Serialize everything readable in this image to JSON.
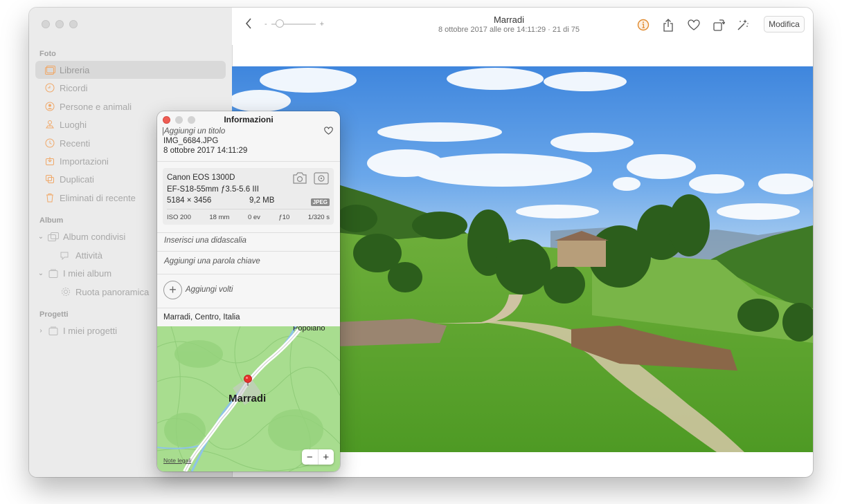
{
  "sidebar": {
    "section_foto": "Foto",
    "items": [
      {
        "label": "Libreria",
        "icon": "library-icon"
      },
      {
        "label": "Ricordi",
        "icon": "memories-icon"
      },
      {
        "label": "Persone e animali",
        "icon": "people-icon"
      },
      {
        "label": "Luoghi",
        "icon": "places-icon"
      },
      {
        "label": "Recenti",
        "icon": "recents-icon"
      },
      {
        "label": "Importazioni",
        "icon": "imports-icon"
      },
      {
        "label": "Duplicati",
        "icon": "duplicates-icon"
      },
      {
        "label": "Eliminati di recente",
        "icon": "trash-icon"
      }
    ],
    "section_album": "Album",
    "album_items": [
      {
        "label": "Album condivisi",
        "icon": "shared-album-icon"
      },
      {
        "label": "Attività",
        "icon": "activity-icon"
      },
      {
        "label": "I miei album",
        "icon": "folder-icon"
      },
      {
        "label": "Ruota panoramica",
        "icon": "gear-icon"
      }
    ],
    "section_progetti": "Progetti",
    "project_items": [
      {
        "label": "I miei progetti",
        "icon": "folder-icon"
      }
    ]
  },
  "toolbar": {
    "title": "Marradi",
    "subtitle": "8 ottobre 2017 alle ore 14:11:29  ·  21 di 75",
    "zoom_minus": "-",
    "zoom_plus": "+",
    "edit_label": "Modifica"
  },
  "info_panel": {
    "title": "Informazioni",
    "title_placeholder": "Aggiungi un titolo",
    "filename": "IMG_6684.JPG",
    "date": "8 ottobre 2017   14:11:29",
    "camera": "Canon EOS 1300D",
    "lens": "EF-S18-55mm ƒ3.5-5.6 III",
    "dimensions": "5184 × 3456",
    "filesize": "9,2 MB",
    "format_badge": "JPEG",
    "iso": "ISO 200",
    "focal": "18 mm",
    "ev": "0 ev",
    "aperture": "ƒ10",
    "shutter": "1/320 s",
    "caption_placeholder": "Inserisci una didascalia",
    "keyword_placeholder": "Aggiungi una parola chiave",
    "add_faces": "Aggiungi volti",
    "location": "Marradi, Centro, Italia",
    "map_city": "Marradi",
    "map_town": "Popolano",
    "legal": "Note legali",
    "zoom_out": "−",
    "zoom_in": "+"
  },
  "colors": {
    "accent_orange": "#f0a868",
    "info_orange": "#e08a2e",
    "map_green": "#a8dd8f",
    "pin_red": "#e5322d"
  }
}
